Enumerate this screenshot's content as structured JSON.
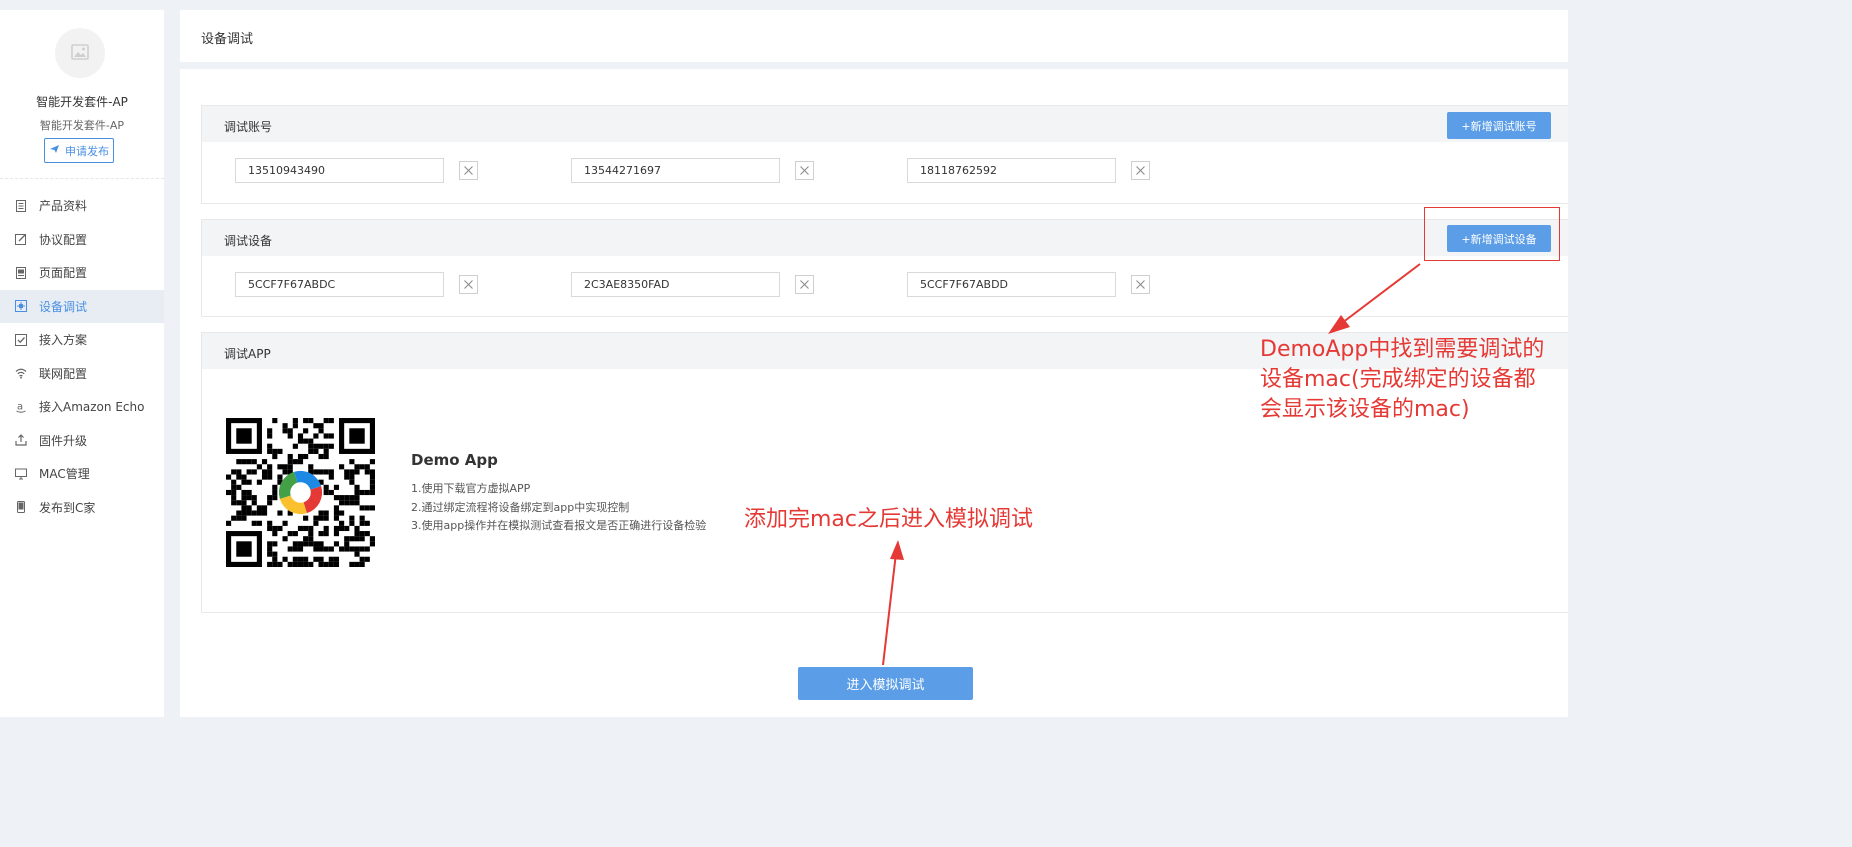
{
  "sidebar": {
    "avatar_icon": "image-icon",
    "product_name": "智能开发套件-AP",
    "product_sub": "智能开发套件-AP",
    "publish_label": "申请发布",
    "items": [
      {
        "label": "产品资料",
        "icon": "doc-icon"
      },
      {
        "label": "协议配置",
        "icon": "edit-icon"
      },
      {
        "label": "页面配置",
        "icon": "page-icon"
      },
      {
        "label": "设备调试",
        "icon": "debug-icon",
        "active": true
      },
      {
        "label": "接入方案",
        "icon": "check-icon"
      },
      {
        "label": "联网配置",
        "icon": "wifi-icon"
      },
      {
        "label": "接入Amazon Echo",
        "icon": "amazon-icon"
      },
      {
        "label": "固件升级",
        "icon": "upload-icon"
      },
      {
        "label": "MAC管理",
        "icon": "monitor-icon"
      },
      {
        "label": "发布到C家",
        "icon": "phone-icon"
      }
    ]
  },
  "header": {
    "title": "设备调试"
  },
  "accounts": {
    "title": "调试账号",
    "add_label": "+新增调试账号",
    "values": [
      "13510943490",
      "13544271697",
      "18118762592"
    ]
  },
  "devices": {
    "title": "调试设备",
    "add_label": "+新增调试设备",
    "values": [
      "5CCF7F67ABDC",
      "2C3AE8350FAD",
      "5CCF7F67ABDD"
    ]
  },
  "app": {
    "title": "调试APP",
    "name": "Demo App",
    "steps": [
      "1.使用下载官方虚拟APP",
      "2.通过绑定流程将设备绑定到app中实现控制",
      "3.使用app操作并在模拟测试查看报文是否正确进行设备检验"
    ]
  },
  "enter_label": "进入模拟调试",
  "annotations": {
    "right_lines": [
      "DemoApp中找到需要调试的",
      "设备mac(完成绑定的设备都",
      "会显示该设备的mac)"
    ],
    "center": "添加完mac之后进入模拟调试",
    "color": "#e53935"
  },
  "colors": {
    "accent": "#5b9de6",
    "active_bg": "#e8edf4",
    "annotation": "#e53935"
  }
}
